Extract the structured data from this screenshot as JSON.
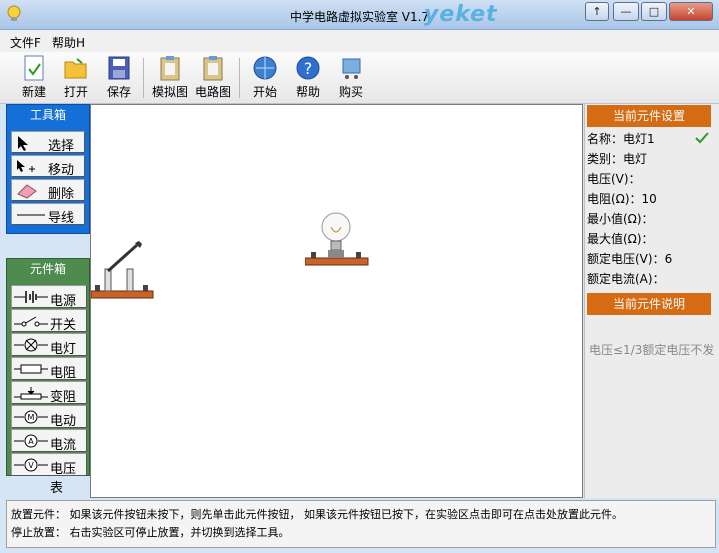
{
  "window": {
    "title": "中学电路虚拟实验室 V1.7",
    "logo": "yeket"
  },
  "menu": [
    "文件F",
    "帮助H"
  ],
  "toolbar": {
    "new": "新建",
    "open": "打开",
    "save": "保存",
    "sim": "模拟图",
    "circuit": "电路图",
    "start": "开始",
    "help": "帮助",
    "buy": "购买"
  },
  "toolbox": {
    "title": "工具箱",
    "items": [
      "选择",
      "移动",
      "删除",
      "导线"
    ]
  },
  "components": {
    "title": "元件箱",
    "items": [
      "电源",
      "开关",
      "电灯",
      "电阻",
      "变阻器",
      "电动机",
      "电流表",
      "电压表"
    ]
  },
  "props": {
    "header": "当前元件设置",
    "name": "名称：电灯1",
    "type": "类别：电灯",
    "voltage": "电压(V)：",
    "resistance": "电阻(Ω)：10",
    "min": "最小值(Ω)：",
    "max": "最大值(Ω)：",
    "rated_v": "额定电压(V)：6",
    "rated_i": "额定电流(A)："
  },
  "desc": {
    "header": "当前元件说明",
    "text": "电压≤1/3额定电压不发"
  },
  "status": {
    "line1": "放置元件：  如果该元件按钮未按下，则先单击此元件按钮，  如果该元件按钮已按下，在实验区点击即可在点击处放置此元件。",
    "line2": "停止放置：  右击实验区可停止放置，并切换到选择工具。"
  },
  "colors": {
    "toolbox": "#1470d8",
    "components": "#4f8a4f",
    "header": "#d56b13"
  }
}
